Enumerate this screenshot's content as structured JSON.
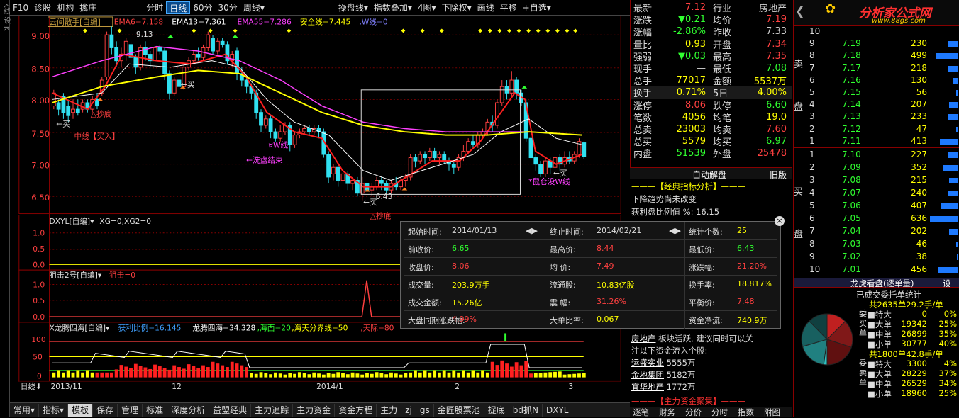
{
  "toolbar": {
    "left": [
      "F10",
      "诊股",
      "机构",
      "擒庄"
    ],
    "periods": [
      "分时",
      "日线",
      "60分",
      "30分",
      "周线▾"
    ],
    "active": "日线",
    "right": [
      "操盘线▾",
      "指数叠加▾",
      "4图▾",
      "下除权▾",
      "画线",
      "平移",
      "+自选▾"
    ]
  },
  "side_label": "K线 设 K",
  "main_chart": {
    "indicator_title": "云间散手[自编]",
    "ema6": "EMA6=7.158",
    "ema13": "EMA13=7.361",
    "ema55": "EMA55=7.286",
    "safe_line": "安全线=7.445",
    "w_line": ",W线=0",
    "y_ticks": [
      "9.00",
      "8.50",
      "8.00",
      "7.50",
      "7.00",
      "6.50"
    ],
    "high_label": "9.13",
    "low_label": "6.43",
    "annotations": {
      "zhongxian": "中线【买入】",
      "xipan": "←洗盘结束",
      "chaodi1": "△抄底",
      "chaodi2": "△抄底",
      "mai1": "←买",
      "mai2": "←买",
      "mai3": "←买",
      "mai4": "←买",
      "shuyan": "*鼠仓没W线",
      "wxian": "¤W线"
    }
  },
  "panel_dxyl": {
    "title": "DXYL[自编]▾",
    "xg": "XG=0,XG2=0",
    "ticks": [
      "1.0",
      "0.5",
      "0.0"
    ]
  },
  "panel_jiji": {
    "title": "狙击2号[自编]▾",
    "val": "狙击=0",
    "ticks": [
      "1.0",
      "0.5",
      "0.0"
    ]
  },
  "panel_xlt": {
    "title": "X龙腾四海[自编]▾",
    "huoli": "获利比例=16.145",
    "longteng": "龙腾四海=34.328",
    "haimian": ",海面=20",
    "fenjie": ",海天分界线=50",
    "tianji": ",天际=80",
    "ticks": [
      "100",
      "50",
      "0"
    ]
  },
  "time_axis": {
    "dayline": "日线⬇",
    "labels": [
      "2013/11",
      "12",
      "2014/1",
      "2",
      "3"
    ]
  },
  "bottom_tabs": [
    "常用▾",
    "指标▾",
    "模板",
    "保存",
    "管理",
    "标准",
    "深度分析",
    "益盟经典",
    "主力追踪",
    "主力资金",
    "资金方程",
    "主力",
    "zj",
    "gs",
    "金匠股票池",
    "捉底",
    "bd抓N",
    "DXYL"
  ],
  "bottom_active": "模板",
  "quote": {
    "rows": [
      {
        "l1": "最新",
        "v1": "7.12",
        "c1": "#ff4040",
        "l2": "行业",
        "v2": "房地产",
        "c2": "#ccc"
      },
      {
        "l1": "涨跌",
        "v1": "▼0.21",
        "c1": "#30ff30",
        "l2": "均价",
        "v2": "7.19",
        "c2": "#ff4040"
      },
      {
        "l1": "涨幅",
        "v1": "-2.86%",
        "c1": "#30ff30",
        "l2": "昨收",
        "v2": "7.33",
        "c2": "#ccc"
      },
      {
        "l1": "量比",
        "v1": "0.93",
        "c1": "#ffff00",
        "l2": "开盘",
        "v2": "7.34",
        "c2": "#ff4040"
      },
      {
        "l1": "强弱",
        "v1": "▼0.03",
        "c1": "#30ff30",
        "l2": "最高",
        "v2": "7.35",
        "c2": "#ff4040"
      },
      {
        "l1": "现手",
        "v1": "—",
        "c1": "#ccc",
        "l2": "最低",
        "v2": "7.08",
        "c2": "#30ff30"
      },
      {
        "l1": "总手",
        "v1": "77017",
        "c1": "#ffff00",
        "l2": "金额",
        "v2": "5537万",
        "c2": "#ffff00"
      },
      {
        "l1": "换手",
        "v1": "0.71%",
        "c1": "#ffff00",
        "l2": "5日",
        "v2": "4.00%",
        "c2": "#ffff00"
      },
      {
        "l1": "涨停",
        "v1": "8.06",
        "c1": "#ff4040",
        "l2": "跌停",
        "v2": "6.60",
        "c2": "#30ff30"
      },
      {
        "l1": "笔数",
        "v1": "4056",
        "c1": "#ffff00",
        "l2": "均笔",
        "v2": "19.0",
        "c2": "#ffff00"
      },
      {
        "l1": "总卖",
        "v1": "23003",
        "c1": "#ffff00",
        "l2": "均卖",
        "v2": "7.60",
        "c2": "#ff4040"
      },
      {
        "l1": "总买",
        "v1": "5579",
        "c1": "#ffff00",
        "l2": "均买",
        "v2": "6.97",
        "c2": "#30ff30"
      },
      {
        "l1": "内盘",
        "v1": "51539",
        "c1": "#30ff30",
        "l2": "外盘",
        "v2": "25478",
        "c2": "#ff4040"
      }
    ]
  },
  "auto_panel": {
    "tab": "自动解盘",
    "tab2": "旧版",
    "header": "———【经典指标分析】———",
    "line1": "下降趋势尚未改变",
    "line2": "获利盘比例值 %: 16.15"
  },
  "popup": {
    "rows": [
      [
        {
          "label": "起始时间:",
          "val": "2014/01/13",
          "vcolor": "#ddd"
        },
        {
          "label": "终止时间:",
          "val": "2014/02/21",
          "vcolor": "#ddd"
        },
        {
          "label": "统计个数:",
          "val": "25",
          "vcolor": "#ffff00"
        }
      ],
      [
        {
          "label": "前收价:",
          "val": "6.65",
          "vcolor": "#30ff30"
        },
        {
          "label": "最高价:",
          "val": "8.44",
          "vcolor": "#ff4040"
        },
        {
          "label": "最低价:",
          "val": "6.43",
          "vcolor": "#30ff30"
        }
      ],
      [
        {
          "label": "收盘价:",
          "val": "8.06",
          "vcolor": "#ff4040"
        },
        {
          "label": "均 价:",
          "val": "7.49",
          "vcolor": "#ff4040"
        },
        {
          "label": "涨跌幅:",
          "val": "21.20%",
          "vcolor": "#ff4040"
        }
      ],
      [
        {
          "label": "成交量:",
          "val": "203.9万手",
          "vcolor": "#ffff00"
        },
        {
          "label": "流通股:",
          "val": "10.83亿股",
          "vcolor": "#ffff00"
        },
        {
          "label": "换手率:",
          "val": "18.817%",
          "vcolor": "#ffff00"
        }
      ],
      [
        {
          "label": "成交金额:",
          "val": "15.26亿",
          "vcolor": "#ffff00"
        },
        {
          "label": "震 幅:",
          "val": "31.26%",
          "vcolor": "#ff4040"
        },
        {
          "label": "平衡价:",
          "val": "7.48",
          "vcolor": "#ff4040"
        }
      ],
      [
        {
          "label": "大盘同期涨跌幅:",
          "val": "4.99%",
          "vcolor": "#ff4040"
        },
        {
          "label": "大单比率:",
          "val": "0.067",
          "vcolor": "#ffff00"
        },
        {
          "label": "资金净流:",
          "val": "740.9万",
          "vcolor": "#ffff00"
        }
      ]
    ],
    "arrows": "◀▶"
  },
  "news": {
    "lines": [
      {
        "a": "房地产",
        "b": " 板块活跃, 建议同时可以关"
      },
      {
        "a": "",
        "b": "注以下资金流入个股:"
      },
      {
        "a": "运盛实业",
        "b": " 5555万"
      },
      {
        "a": "金地集团",
        "b": " 5182万"
      },
      {
        "a": "宜华地产",
        "b": " 1772万"
      }
    ],
    "header": "———【主力资金聚集】———",
    "tabs": [
      "逐笔",
      "财务",
      "分价",
      "分时",
      "指数",
      "附图"
    ]
  },
  "orderbook": {
    "logo": "分析家公式网",
    "url": "www.88gs.com",
    "sell_label": [
      "卖",
      "盘"
    ],
    "buy_label": [
      "买",
      "盘"
    ],
    "sell": [
      {
        "lvl": "10",
        "price": "",
        "vol": ""
      },
      {
        "lvl": "9",
        "price": "7.19",
        "vol": "230"
      },
      {
        "lvl": "8",
        "price": "7.18",
        "vol": "499"
      },
      {
        "lvl": "7",
        "price": "7.17",
        "vol": "218"
      },
      {
        "lvl": "6",
        "price": "7.16",
        "vol": "130"
      },
      {
        "lvl": "5",
        "price": "7.15",
        "vol": "56"
      },
      {
        "lvl": "4",
        "price": "7.14",
        "vol": "207"
      },
      {
        "lvl": "3",
        "price": "7.13",
        "vol": "233"
      },
      {
        "lvl": "2",
        "price": "7.12",
        "vol": "47"
      },
      {
        "lvl": "1",
        "price": "7.11",
        "vol": "413"
      }
    ],
    "buy": [
      {
        "lvl": "1",
        "price": "7.10",
        "vol": "227"
      },
      {
        "lvl": "2",
        "price": "7.09",
        "vol": "352"
      },
      {
        "lvl": "3",
        "price": "7.08",
        "vol": "215"
      },
      {
        "lvl": "4",
        "price": "7.07",
        "vol": "240"
      },
      {
        "lvl": "5",
        "price": "7.06",
        "vol": "407"
      },
      {
        "lvl": "6",
        "price": "7.05",
        "vol": "636"
      },
      {
        "lvl": "7",
        "price": "7.04",
        "vol": "202"
      },
      {
        "lvl": "8",
        "price": "7.03",
        "vol": "46"
      },
      {
        "lvl": "9",
        "price": "7.02",
        "vol": "38"
      },
      {
        "lvl": "10",
        "price": "7.01",
        "vol": "456"
      }
    ]
  },
  "longhu": {
    "title": "龙虎看盘(逐单量)",
    "set": "设",
    "subtitle": "已成交委托单统计",
    "buy_total": "共2635单29.2手/单",
    "sell_total": "共1800单42.8手/单",
    "buy_side": "委买单",
    "sell_side": "委卖单",
    "buy_rows": [
      {
        "n": "特大",
        "v": "0",
        "p": "0%"
      },
      {
        "n": "大单",
        "v": "19342",
        "p": "25%"
      },
      {
        "n": "中单",
        "v": "26899",
        "p": "35%"
      },
      {
        "n": "小单",
        "v": "30777",
        "p": "40%"
      }
    ],
    "sell_rows": [
      {
        "n": "特大",
        "v": "3300",
        "p": "4%"
      },
      {
        "n": "大单",
        "v": "28229",
        "p": "37%"
      },
      {
        "n": "中单",
        "v": "26529",
        "p": "34%"
      },
      {
        "n": "小单",
        "v": "18960",
        "p": "25%"
      }
    ]
  }
}
